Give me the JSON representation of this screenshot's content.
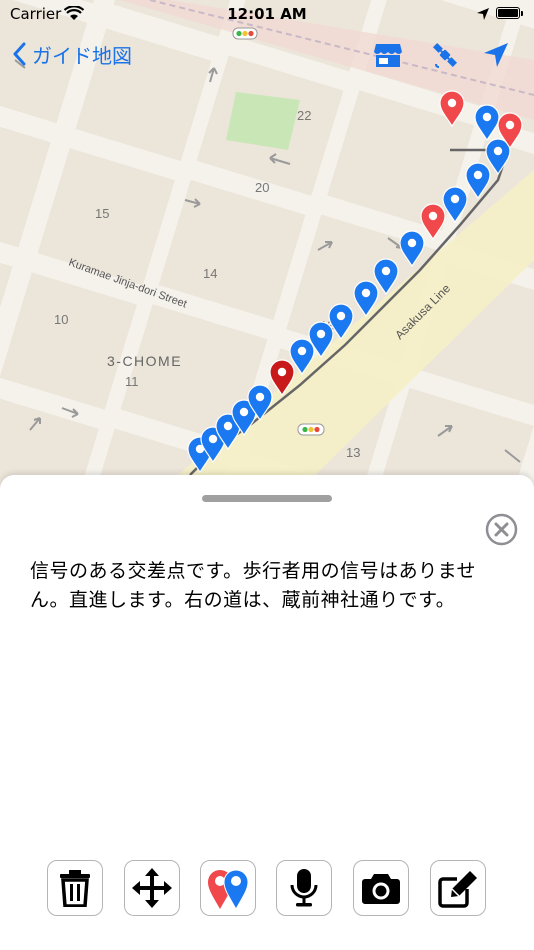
{
  "status_bar": {
    "carrier": "Carrier",
    "time": "12:01 AM"
  },
  "nav": {
    "back_label": "ガイド地図",
    "accent_color": "#1a73e8",
    "icons": [
      "store-icon",
      "satellite-icon",
      "location-arrow-icon"
    ]
  },
  "map": {
    "block_labels": [
      "22",
      "20",
      "15",
      "14",
      "10",
      "11",
      "13",
      "13"
    ],
    "district_label": "3-CHOME",
    "street_label": "Kuramae Jinja-dori Street",
    "rail_label": "Asakusa Line",
    "pin_colors": {
      "blue": "#1a78f0",
      "red": "#f0484b",
      "dark_red": "#c81a1a"
    }
  },
  "sheet": {
    "description": "信号のある交差点です。歩行者用の信号はありません。直進します。右の道は、蔵前神社通りです。"
  },
  "toolbar": {
    "buttons": [
      "trash-icon",
      "move-icon",
      "pins-icon",
      "microphone-icon",
      "camera-icon",
      "edit-icon"
    ]
  }
}
